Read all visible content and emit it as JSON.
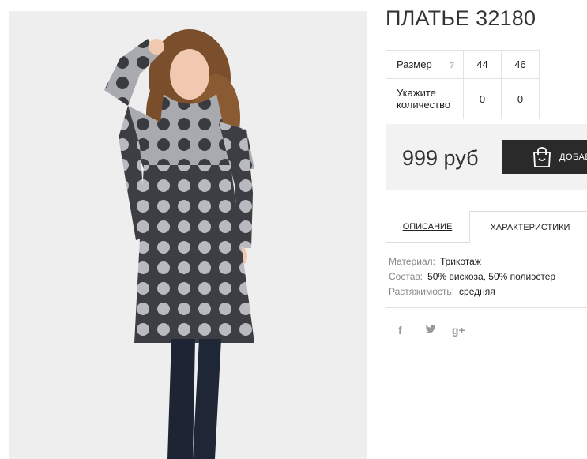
{
  "product": {
    "title": "ПЛАТЬЕ 32180"
  },
  "sizes": {
    "size_label": "Размер",
    "help_icon": "?",
    "qty_label": "Укажите количество",
    "columns": [
      "44",
      "46"
    ],
    "quantities": [
      "0",
      "0"
    ]
  },
  "price": {
    "value": "999 руб",
    "cart_button_label": "ДОБАВ",
    "cart_icon": "shopping-bag-icon"
  },
  "tabs": {
    "description": "ОПИСАНИЕ",
    "characteristics": "ХАРАКТЕРИСТИКИ",
    "active": "characteristics"
  },
  "characteristics": [
    {
      "key": "Материал:",
      "value": "Трикотаж"
    },
    {
      "key": "Состав:",
      "value": "50% вискоза, 50% полиэстер"
    },
    {
      "key": "Растяжимость:",
      "value": "средняя"
    }
  ],
  "social": {
    "facebook": "f",
    "twitter": "🐦",
    "googleplus": "g+"
  },
  "colors": {
    "button_bg": "#2a2a2a",
    "price_bg": "#f2f2f2",
    "dress_dark": "#3c3d42",
    "dress_light": "#b8b9bd"
  }
}
